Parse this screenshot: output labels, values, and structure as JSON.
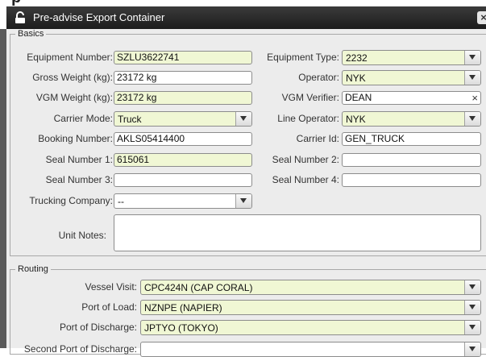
{
  "window": {
    "title": "Pre-advise Export Container",
    "header_fragment": "p"
  },
  "basics": {
    "legend": "Basics",
    "equipment_number": {
      "label": "Equipment Number:",
      "value": "SZLU3622741"
    },
    "equipment_type": {
      "label": "Equipment Type:",
      "value": "2232"
    },
    "gross_weight": {
      "label": "Gross Weight (kg):",
      "value": "23172 kg"
    },
    "operator": {
      "label": "Operator:",
      "value": "NYK"
    },
    "vgm_weight": {
      "label": "VGM Weight (kg):",
      "value": "23172 kg"
    },
    "vgm_verifier": {
      "label": "VGM Verifier:",
      "value": "DEAN"
    },
    "carrier_mode": {
      "label": "Carrier Mode:",
      "value": "Truck"
    },
    "line_operator": {
      "label": "Line Operator:",
      "value": "NYK"
    },
    "booking_number": {
      "label": "Booking Number:",
      "value": "AKLS05414400"
    },
    "carrier_id": {
      "label": "Carrier Id:",
      "value": "GEN_TRUCK"
    },
    "seal_number_1": {
      "label": "Seal Number 1:",
      "value": "615061"
    },
    "seal_number_2": {
      "label": "Seal Number 2:",
      "value": ""
    },
    "seal_number_3": {
      "label": "Seal Number 3:",
      "value": ""
    },
    "seal_number_4": {
      "label": "Seal Number 4:",
      "value": ""
    },
    "trucking_company": {
      "label": "Trucking Company:",
      "value": "--"
    },
    "unit_notes": {
      "label": "Unit Notes:",
      "value": ""
    }
  },
  "routing": {
    "legend": "Routing",
    "vessel_visit": {
      "label": "Vessel Visit:",
      "value": "CPC424N (CAP CORAL)"
    },
    "port_of_load": {
      "label": "Port of Load:",
      "value": "NZNPE (NAPIER)"
    },
    "port_of_discharge": {
      "label": "Port of Discharge:",
      "value": "JPTYO (TOKYO)"
    },
    "second_port_of_discharge": {
      "label": "Second Port of Discharge:",
      "value": ""
    }
  },
  "colors": {
    "titlebar": "#2a2a2a",
    "required_field": "#f0f7d4",
    "panel": "#ececec"
  },
  "icons": {
    "title": "lock-icon",
    "close": "close-icon",
    "dropdown": "chevron-down-icon",
    "clear": "clear-icon"
  }
}
